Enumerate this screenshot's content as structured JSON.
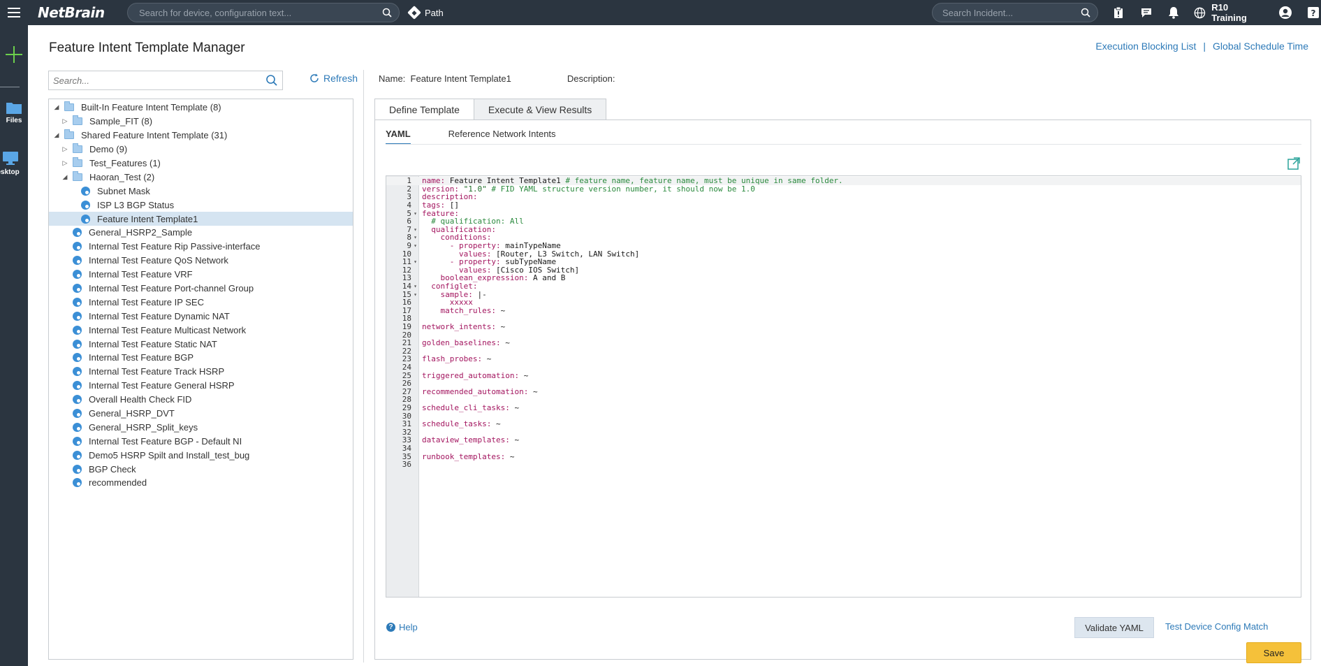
{
  "topbar": {
    "logo": "NetBrain",
    "search_placeholder": "Search for device, configuration text...",
    "path_label": "Path",
    "incident_placeholder": "Search Incident...",
    "user_label": "R10 Training"
  },
  "rail": {
    "files_label": "Files",
    "desktop_label": "Desktop"
  },
  "page": {
    "title": "Feature Intent Template Manager",
    "link_execution": "Execution Blocking List",
    "link_separator": "|",
    "link_schedule": "Global Schedule Time"
  },
  "left": {
    "search_placeholder": "Search...",
    "refresh_label": "Refresh"
  },
  "tree": [
    {
      "label": "Built-In Feature Intent Template (8)",
      "type": "folder",
      "toggle": "open",
      "depth": 0
    },
    {
      "label": "Sample_FIT (8)",
      "type": "folder",
      "toggle": "closed",
      "depth": 1
    },
    {
      "label": "Shared Feature Intent Template (31)",
      "type": "folder",
      "toggle": "open",
      "depth": 0
    },
    {
      "label": "Demo (9)",
      "type": "folder",
      "toggle": "closed",
      "depth": 1
    },
    {
      "label": "Test_Features (1)",
      "type": "folder",
      "toggle": "closed",
      "depth": 1
    },
    {
      "label": "Haoran_Test (2)",
      "type": "folder",
      "toggle": "open",
      "depth": 1
    },
    {
      "label": "Subnet Mask",
      "type": "fit",
      "depth": 2
    },
    {
      "label": "ISP L3 BGP Status",
      "type": "fit",
      "depth": 2
    },
    {
      "label": "Feature Intent Template1",
      "type": "fit",
      "depth": 2,
      "selected": true
    },
    {
      "label": "General_HSRP2_Sample",
      "type": "fit",
      "depth": 1
    },
    {
      "label": "Internal Test Feature Rip Passive-interface",
      "type": "fit",
      "depth": 1
    },
    {
      "label": "Internal Test Feature QoS Network",
      "type": "fit",
      "depth": 1
    },
    {
      "label": "Internal Test Feature VRF",
      "type": "fit",
      "depth": 1
    },
    {
      "label": "Internal Test Feature Port-channel Group",
      "type": "fit",
      "depth": 1
    },
    {
      "label": "Internal Test Feature IP SEC",
      "type": "fit",
      "depth": 1
    },
    {
      "label": "Internal Test Feature Dynamic NAT",
      "type": "fit",
      "depth": 1
    },
    {
      "label": "Internal Test Feature Multicast Network",
      "type": "fit",
      "depth": 1
    },
    {
      "label": "Internal Test Feature Static NAT",
      "type": "fit",
      "depth": 1
    },
    {
      "label": "Internal Test Feature BGP",
      "type": "fit",
      "depth": 1
    },
    {
      "label": "Internal Test Feature Track HSRP",
      "type": "fit",
      "depth": 1
    },
    {
      "label": "Internal Test Feature General HSRP",
      "type": "fit",
      "depth": 1
    },
    {
      "label": "Overall Health Check FID",
      "type": "fit",
      "depth": 1
    },
    {
      "label": "General_HSRP_DVT",
      "type": "fit",
      "depth": 1
    },
    {
      "label": "General_HSRP_Split_keys",
      "type": "fit",
      "depth": 1
    },
    {
      "label": "Internal Test Feature BGP - Default NI",
      "type": "fit",
      "depth": 1
    },
    {
      "label": "Demo5 HSRP Spilt and Install_test_bug",
      "type": "fit",
      "depth": 1
    },
    {
      "label": "BGP Check",
      "type": "fit",
      "depth": 1
    },
    {
      "label": "recommended",
      "type": "fit",
      "depth": 1
    }
  ],
  "detail": {
    "name_label": "Name:",
    "name_value": "Feature Intent Template1",
    "description_label": "Description:",
    "tabs": [
      "Define Template",
      "Execute & View Results"
    ],
    "subtabs": [
      "YAML",
      "Reference Network Intents"
    ],
    "help_label": "Help",
    "validate_label": "Validate YAML",
    "test_link": "Test Device Config Match",
    "save_label": "Save"
  },
  "yaml_lines": [
    {
      "n": "1",
      "fold": "",
      "parts": [
        [
          "k",
          "name: "
        ],
        [
          "v",
          "Feature Intent Template1 "
        ],
        [
          "c",
          "# feature name, feature name, must be unique in same folder."
        ]
      ]
    },
    {
      "n": "2",
      "fold": "",
      "parts": [
        [
          "k",
          "version: "
        ],
        [
          "s",
          "\"1.0\" "
        ],
        [
          "c",
          "# FID YAML structure version number, it should now be 1.0"
        ]
      ]
    },
    {
      "n": "3",
      "fold": "",
      "parts": [
        [
          "k",
          "description:"
        ]
      ]
    },
    {
      "n": "4",
      "fold": "",
      "parts": [
        [
          "k",
          "tags: "
        ],
        [
          "v",
          "[]"
        ]
      ]
    },
    {
      "n": "5",
      "fold": "▾",
      "parts": [
        [
          "k",
          "feature:"
        ]
      ]
    },
    {
      "n": "6",
      "fold": "",
      "parts": [
        [
          "c",
          "  # qualification: All"
        ]
      ]
    },
    {
      "n": "7",
      "fold": "▾",
      "parts": [
        [
          "k",
          "  qualification:"
        ]
      ]
    },
    {
      "n": "8",
      "fold": "▾",
      "parts": [
        [
          "k",
          "    conditions:"
        ]
      ]
    },
    {
      "n": "9",
      "fold": "▾",
      "parts": [
        [
          "k",
          "      - property: "
        ],
        [
          "v",
          "mainTypeName"
        ]
      ]
    },
    {
      "n": "10",
      "fold": "",
      "parts": [
        [
          "k",
          "        values: "
        ],
        [
          "v",
          "[Router, L3 Switch, LAN Switch]"
        ]
      ]
    },
    {
      "n": "11",
      "fold": "▾",
      "parts": [
        [
          "k",
          "      - property: "
        ],
        [
          "v",
          "subTypeName"
        ]
      ]
    },
    {
      "n": "12",
      "fold": "",
      "parts": [
        [
          "k",
          "        values: "
        ],
        [
          "v",
          "[Cisco IOS Switch]"
        ]
      ]
    },
    {
      "n": "13",
      "fold": "",
      "parts": [
        [
          "k",
          "    boolean_expression: "
        ],
        [
          "v",
          "A and B"
        ]
      ]
    },
    {
      "n": "14",
      "fold": "▾",
      "parts": [
        [
          "k",
          "  configlet:"
        ]
      ]
    },
    {
      "n": "15",
      "fold": "▾",
      "parts": [
        [
          "k",
          "    sample: "
        ],
        [
          "v",
          "|-"
        ]
      ]
    },
    {
      "n": "16",
      "fold": "",
      "parts": [
        [
          "k",
          "      xxxxx"
        ]
      ]
    },
    {
      "n": "17",
      "fold": "",
      "parts": [
        [
          "k",
          "    match_rules: "
        ],
        [
          "v",
          "~"
        ]
      ]
    },
    {
      "n": "18",
      "fold": "",
      "parts": []
    },
    {
      "n": "19",
      "fold": "",
      "parts": [
        [
          "k",
          "network_intents: "
        ],
        [
          "v",
          "~"
        ]
      ]
    },
    {
      "n": "20",
      "fold": "",
      "parts": []
    },
    {
      "n": "21",
      "fold": "",
      "parts": [
        [
          "k",
          "golden_baselines: "
        ],
        [
          "v",
          "~"
        ]
      ]
    },
    {
      "n": "22",
      "fold": "",
      "parts": []
    },
    {
      "n": "23",
      "fold": "",
      "parts": [
        [
          "k",
          "flash_probes: "
        ],
        [
          "v",
          "~"
        ]
      ]
    },
    {
      "n": "24",
      "fold": "",
      "parts": []
    },
    {
      "n": "25",
      "fold": "",
      "parts": [
        [
          "k",
          "triggered_automation: "
        ],
        [
          "v",
          "~"
        ]
      ]
    },
    {
      "n": "26",
      "fold": "",
      "parts": []
    },
    {
      "n": "27",
      "fold": "",
      "parts": [
        [
          "k",
          "recommended_automation: "
        ],
        [
          "v",
          "~"
        ]
      ]
    },
    {
      "n": "28",
      "fold": "",
      "parts": []
    },
    {
      "n": "29",
      "fold": "",
      "parts": [
        [
          "k",
          "schedule_cli_tasks: "
        ],
        [
          "v",
          "~"
        ]
      ]
    },
    {
      "n": "30",
      "fold": "",
      "parts": []
    },
    {
      "n": "31",
      "fold": "",
      "parts": [
        [
          "k",
          "schedule_tasks: "
        ],
        [
          "v",
          "~"
        ]
      ]
    },
    {
      "n": "32",
      "fold": "",
      "parts": []
    },
    {
      "n": "33",
      "fold": "",
      "parts": [
        [
          "k",
          "dataview_templates: "
        ],
        [
          "v",
          "~"
        ]
      ]
    },
    {
      "n": "34",
      "fold": "",
      "parts": []
    },
    {
      "n": "35",
      "fold": "",
      "parts": [
        [
          "k",
          "runbook_templates: "
        ],
        [
          "v",
          "~"
        ]
      ]
    },
    {
      "n": "36",
      "fold": "",
      "parts": []
    }
  ]
}
